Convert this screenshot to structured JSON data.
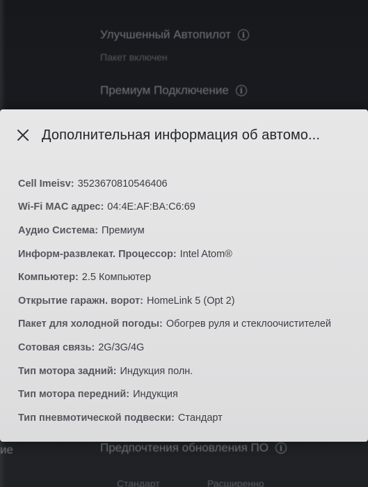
{
  "background": {
    "items": [
      {
        "label": "Улучшенный Автопилот",
        "icon": "info-icon"
      },
      {
        "label": "Пакет включен"
      },
      {
        "label": "Премиум Подключение",
        "icon": "info-icon"
      },
      {
        "label": "Предпочтения обновления ПО",
        "icon": "info-icon"
      },
      {
        "label": "ие"
      },
      {
        "label": "Стандарт"
      },
      {
        "label": "Расширенно"
      }
    ]
  },
  "modal": {
    "title": "Дополнительная информация об автомо...",
    "close_icon": "close-icon",
    "rows": [
      {
        "label": "Cell Imeisv:",
        "value": "3523670810546406"
      },
      {
        "label": "Wi-Fi MAC адрес:",
        "value": "04:4E:AF:BA:C6:69"
      },
      {
        "label": "Аудио Система:",
        "value": "Премиум"
      },
      {
        "label": "Информ-развлекат. Процессор:",
        "value": "Intel Atom®"
      },
      {
        "label": "Компьютер:",
        "value": "2.5 Компьютер"
      },
      {
        "label": "Открытие гаражн. ворот:",
        "value": "HomeLink 5 (Opt 2)"
      },
      {
        "label": "Пакет для холодной погоды:",
        "value": "Обогрев руля и стеклоочистителей"
      },
      {
        "label": "Сотовая связь:",
        "value": "2G/3G/4G"
      },
      {
        "label": "Тип мотора задний:",
        "value": "Индукция полн."
      },
      {
        "label": "Тип мотора передний:",
        "value": "Индукция"
      },
      {
        "label": "Тип пневмотической подвески:",
        "value": "Стандарт"
      }
    ]
  }
}
